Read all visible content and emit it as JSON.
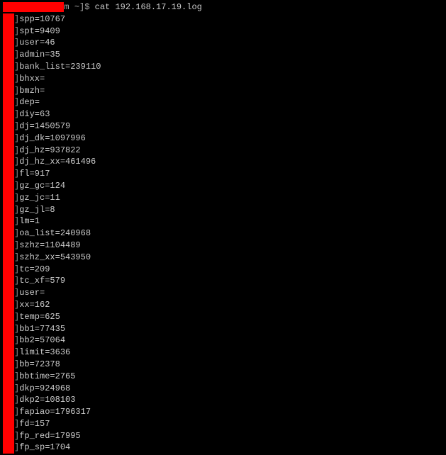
{
  "top_fragment": "",
  "prompt": {
    "user_host_masked": "            ",
    "path": "m ~]$",
    "command": "cat 192.168.17.19.log"
  },
  "lines": [
    {
      "key": "spp",
      "value": "10767"
    },
    {
      "key": "spt",
      "value": "9409"
    },
    {
      "key": "user",
      "value": "46"
    },
    {
      "key": "admin",
      "value": "35"
    },
    {
      "key": "bank_list",
      "value": "239110"
    },
    {
      "key": "bhxx",
      "value": ""
    },
    {
      "key": "bmzh",
      "value": ""
    },
    {
      "key": "dep",
      "value": ""
    },
    {
      "key": "diy",
      "value": "63"
    },
    {
      "key": "dj",
      "value": "1450579"
    },
    {
      "key": "dj_dk",
      "value": "1097996"
    },
    {
      "key": "dj_hz",
      "value": "937822"
    },
    {
      "key": "dj_hz_xx",
      "value": "461496"
    },
    {
      "key": "fl",
      "value": "917"
    },
    {
      "key": "gz_gc",
      "value": "124"
    },
    {
      "key": "gz_jc",
      "value": "11"
    },
    {
      "key": "gz_jl",
      "value": "8"
    },
    {
      "key": "lm",
      "value": "1"
    },
    {
      "key": "oa_list",
      "value": "240968"
    },
    {
      "key": "szhz",
      "value": "1104489"
    },
    {
      "key": "szhz_xx",
      "value": "543950"
    },
    {
      "key": "tc",
      "value": "209"
    },
    {
      "key": "tc_xf",
      "value": "579"
    },
    {
      "key": "user",
      "value": ""
    },
    {
      "key": "xx",
      "value": "162"
    },
    {
      "key": "temp",
      "value": "625"
    },
    {
      "key": "bb1",
      "value": "77435"
    },
    {
      "key": "bb2",
      "value": "57064"
    },
    {
      "key": "limit",
      "value": "3636"
    },
    {
      "key": "bb",
      "value": "72378"
    },
    {
      "key": "bbtime",
      "value": "2765"
    },
    {
      "key": "dkp",
      "value": "924968"
    },
    {
      "key": "dkp2",
      "value": "108103"
    },
    {
      "key": "fapiao",
      "value": "1796317"
    },
    {
      "key": "fd",
      "value": "157"
    },
    {
      "key": "fp_red",
      "value": "17995"
    },
    {
      "key": "fp_sp",
      "value": "1704"
    }
  ]
}
